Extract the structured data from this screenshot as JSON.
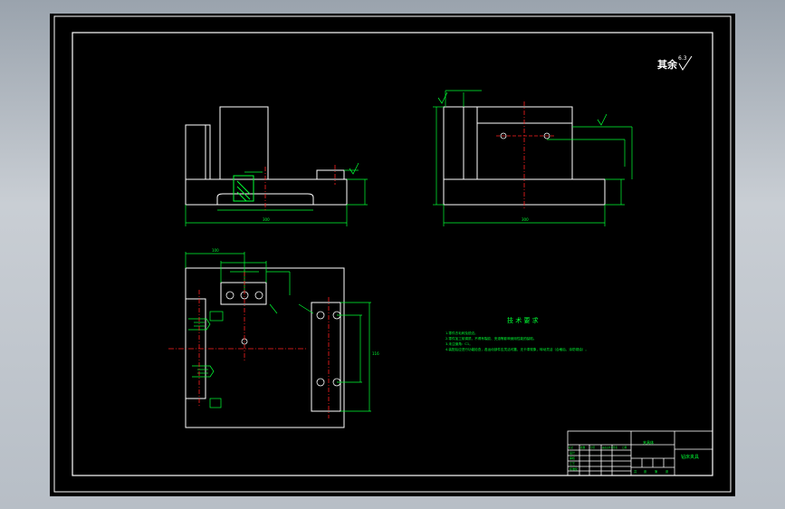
{
  "drawing": {
    "roughness_symbol_text": "其余",
    "roughness_value": "6.3",
    "tech_requirements": {
      "title": "技 术 要 求",
      "items": [
        "1.零件去毛刺及锐边。",
        "2.零件加工前调质，不得有裂纹、夹渣等影响使用性能的缺陷。",
        "3.未注倒角：C1。",
        "4.装配后应进行功能检查，各运动部件应灵活可靠，无卡滞现象，转动灵活（合格后，涂防锈油）。"
      ]
    },
    "title_block": {
      "drawing_name": "钻床夹具",
      "scale_label": "夹具体",
      "row_labels": [
        "设计",
        "审核",
        "工艺",
        "标准化"
      ],
      "col_labels": [
        "标记",
        "处数",
        "分区",
        "更改文件号",
        "签名",
        "日期"
      ],
      "bottom_labels": [
        "共",
        "张",
        "第",
        "张"
      ]
    },
    "colors": {
      "background": "#000000",
      "frame": "#ffffff",
      "dimension": "#00ff33",
      "centerline": "#ff2020",
      "title_text": "#00ff33"
    }
  }
}
